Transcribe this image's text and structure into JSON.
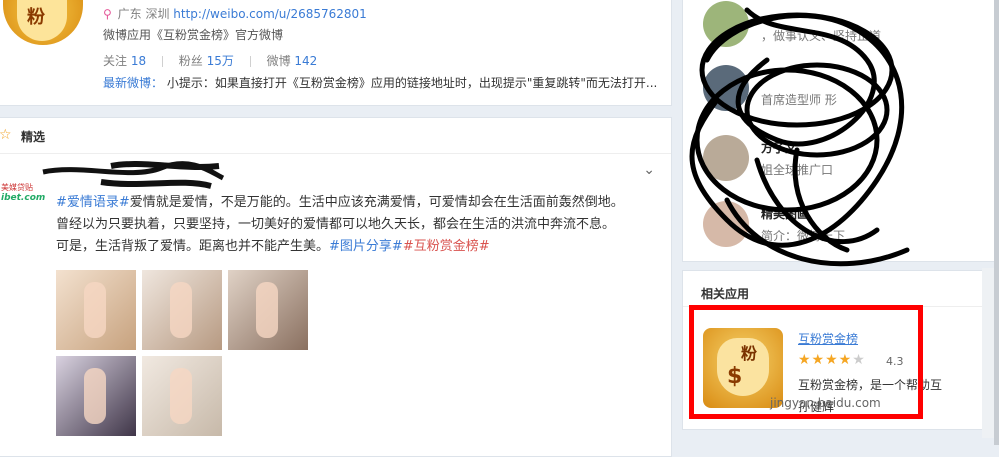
{
  "profile": {
    "location": "广东 深圳",
    "url": "http://weibo.com/u/2685762801",
    "desc": "微博应用《互粉赏金榜》官方微博",
    "avatar_glyph": "粉",
    "stats": [
      {
        "label": "关注",
        "value": "18"
      },
      {
        "label": "粉丝",
        "value": "15万"
      },
      {
        "label": "微博",
        "value": "142"
      }
    ],
    "latest_label": "最新微博：",
    "latest_text": "小提示：如果直接打开《互粉赏金榜》应用的链接地址时，出现提示\"重复跳转\"而无法打开..."
  },
  "featured": {
    "title": "精选",
    "logo_line1": "美媒贷贴",
    "logo_line2": "ibet.com",
    "tag1": "#爱情语录#",
    "text1": "爱情就是爱情，不是万能的。生活中应该充满爱情，可爱情却会在生活面前轰然倒地。",
    "text2": "曾经以为只要执着，只要坚持，一切美好的爱情都可以地久天长，都会在生活的洪流中奔流不息。",
    "text3": "可是，生活背叛了爱情。距离也并不能产生美。",
    "tag2": "#图片分享#",
    "tag3": "#互粉赏金榜#"
  },
  "recommend": {
    "items": [
      {
        "name": "",
        "sub": "，做事认义、坚持正道"
      },
      {
        "name": "",
        "sub": "首席造型师 形"
      },
      {
        "name": "方子文",
        "sub": "姐全球推广口"
      },
      {
        "name": "精美图画",
        "sub": "简介：微博天下"
      }
    ]
  },
  "apps": {
    "title": "相关应用",
    "app_name": "互粉赏金榜",
    "rating": "4.3",
    "stars_full": "★★★★",
    "stars_empty": "★",
    "desc": "互粉赏金榜，是一个帮助互",
    "author": "孙健辉",
    "icon_glyph": "粉",
    "watermark": "jingyan.baidu.com",
    "highlight_color": "#ff0000"
  }
}
